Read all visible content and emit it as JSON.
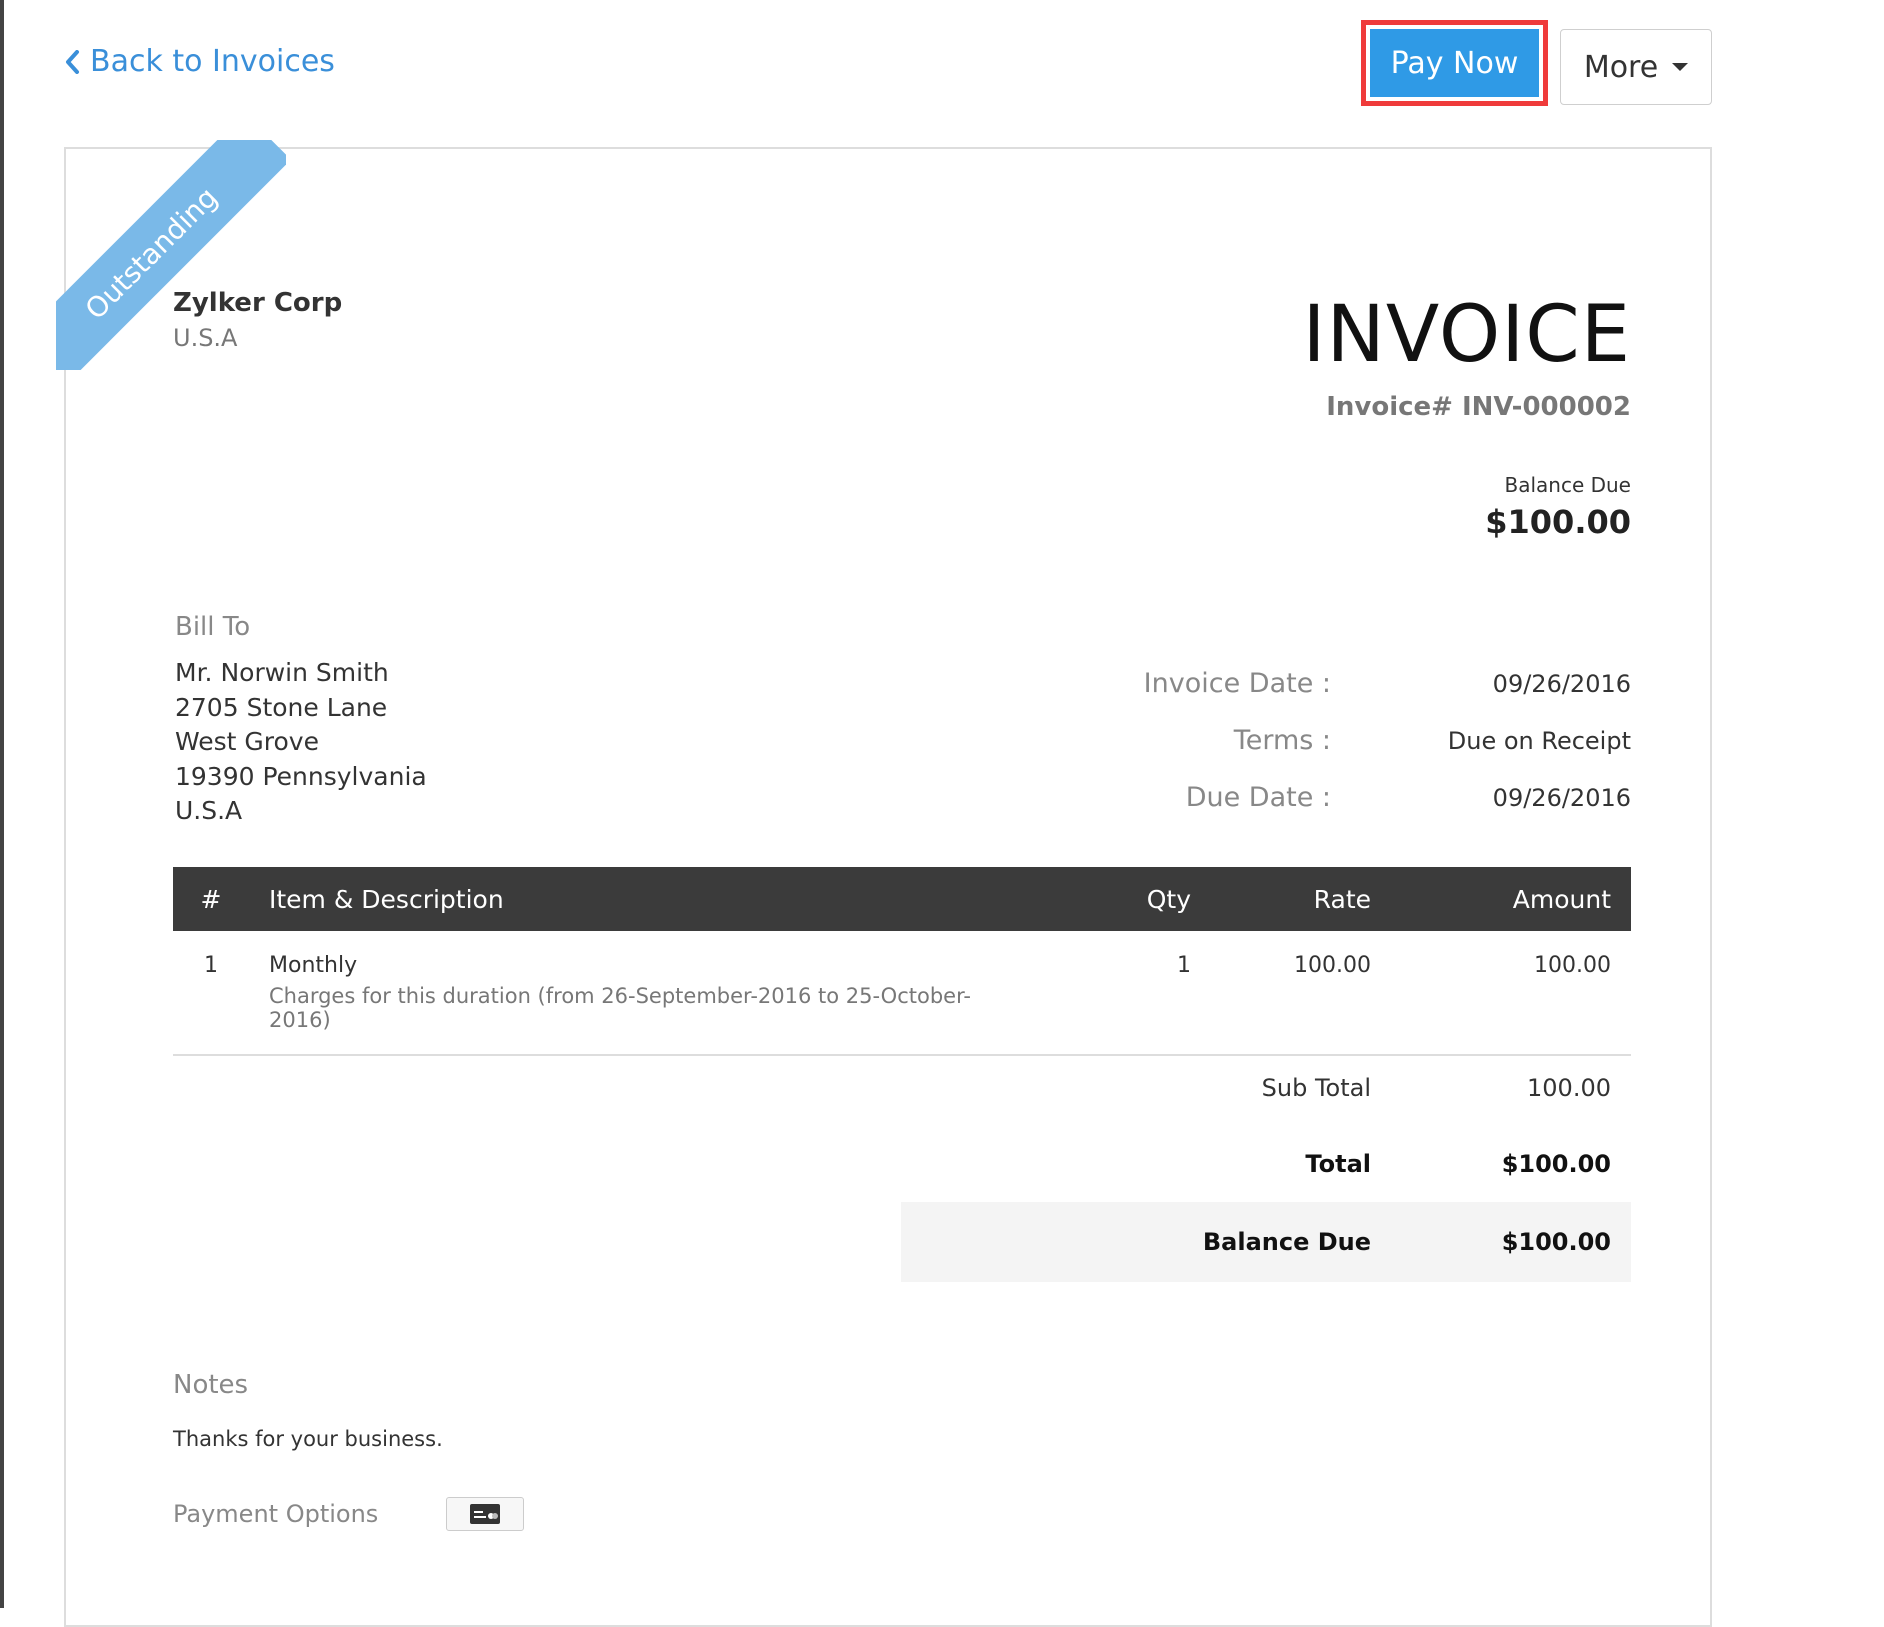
{
  "nav": {
    "back_label": "Back to Invoices"
  },
  "actions": {
    "pay_now_label": "Pay Now",
    "more_label": "More"
  },
  "status": {
    "ribbon": "Outstanding"
  },
  "company": {
    "name": "Zylker Corp",
    "country": "U.S.A"
  },
  "invoice": {
    "title": "INVOICE",
    "number_text": "Invoice# INV-000002",
    "balance_due_label": "Balance Due",
    "balance_due_amount": "$100.00"
  },
  "bill_to": {
    "label": "Bill To",
    "lines": [
      "Mr. Norwin Smith",
      "2705 Stone Lane",
      "West Grove",
      "19390 Pennsylvania",
      "U.S.A"
    ]
  },
  "meta": [
    {
      "label": "Invoice Date :",
      "value": "09/26/2016"
    },
    {
      "label": "Terms :",
      "value": "Due on Receipt"
    },
    {
      "label": "Due Date :",
      "value": "09/26/2016"
    }
  ],
  "table": {
    "headers": [
      "#",
      "Item & Description",
      "Qty",
      "Rate",
      "Amount"
    ],
    "rows": [
      {
        "index": "1",
        "item": "Monthly",
        "description": "Charges for this duration (from 26-September-2016 to 25-October-2016)",
        "qty": "1",
        "rate": "100.00",
        "amount": "100.00"
      }
    ]
  },
  "totals": {
    "sub_total_label": "Sub Total",
    "sub_total_value": "100.00",
    "total_label": "Total",
    "total_value": "$100.00",
    "balance_due_label": "Balance Due",
    "balance_due_value": "$100.00"
  },
  "notes": {
    "label": "Notes",
    "text": "Thanks for your business."
  },
  "payment": {
    "label": "Payment Options",
    "icon": "credit-card-icon"
  },
  "colors": {
    "accent": "#2f9ae6",
    "highlight_border": "#ef3b3b",
    "ribbon": "#7ab9e8",
    "table_header": "#3b3b3b"
  }
}
